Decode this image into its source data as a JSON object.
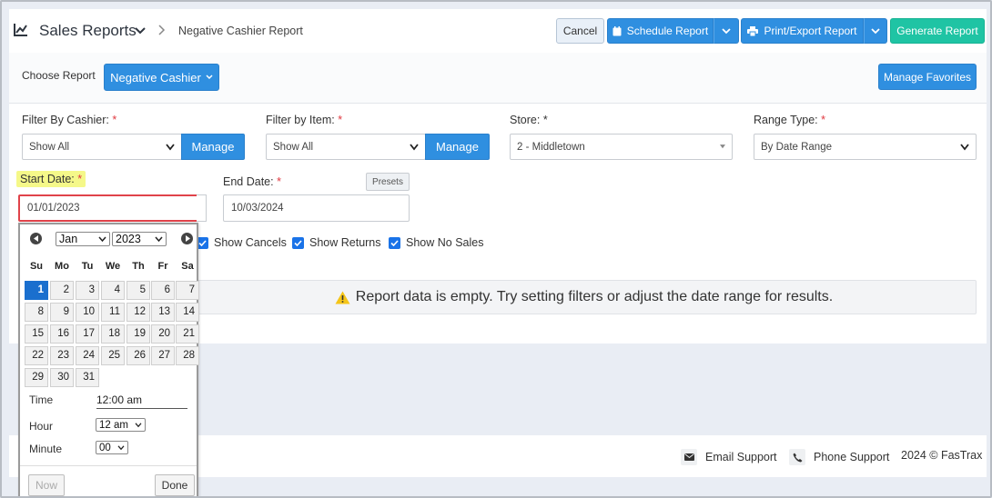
{
  "header": {
    "app_title": "Sales Reports",
    "breadcrumb": "Negative Cashier Report",
    "buttons": {
      "cancel": "Cancel",
      "schedule": "Schedule Report",
      "print_export": "Print/Export Report",
      "generate": "Generate Report"
    }
  },
  "choose_report": {
    "label": "Choose Report",
    "selected": "Negative Cashier",
    "manage_favorites": "Manage Favorites"
  },
  "filters": {
    "cashier": {
      "label": "Filter By Cashier:",
      "required": "*",
      "value": "Show All",
      "manage": "Manage"
    },
    "item": {
      "label": "Filter by Item:",
      "required": "*",
      "value": "Show All",
      "manage": "Manage"
    },
    "store": {
      "label": "Store: *",
      "value": "2 - Middletown"
    },
    "range_type": {
      "label": "Range Type:",
      "required": "*",
      "value": "By Date Range"
    },
    "start_date": {
      "label": "Start Date:",
      "required": "*",
      "value": "01/01/2023"
    },
    "end_date": {
      "label": "End Date:",
      "required": "*",
      "value": "10/03/2024"
    },
    "presets": "Presets"
  },
  "options": {
    "show_cancels": "Show Cancels",
    "show_returns": "Show Returns",
    "show_no_sales": "Show No Sales"
  },
  "empty_message": "Report data is empty. Try setting filters or adjust the date range for results.",
  "footer": {
    "email_support": "Email Support",
    "phone_support": "Phone Support",
    "copyright": "2024 © FasTrax"
  },
  "datepicker": {
    "month": "Jan",
    "year": "2023",
    "weekdays": [
      "Su",
      "Mo",
      "Tu",
      "We",
      "Th",
      "Fr",
      "Sa"
    ],
    "selected_day": "1",
    "days": [
      "1",
      "2",
      "3",
      "4",
      "5",
      "6",
      "7",
      "8",
      "9",
      "10",
      "11",
      "12",
      "13",
      "14",
      "15",
      "16",
      "17",
      "18",
      "19",
      "20",
      "21",
      "22",
      "23",
      "24",
      "25",
      "26",
      "27",
      "28",
      "29",
      "30",
      "31"
    ],
    "time_label": "Time",
    "time_value": "12:00 am",
    "hour_label": "Hour",
    "hour_value": "12 am",
    "minute_label": "Minute",
    "minute_value": "00",
    "now": "Now",
    "done": "Done"
  },
  "colors": {
    "primary_blue": "#2f8fe0",
    "generate_green": "#1fc4a4",
    "required_red": "#e0383f",
    "highlight_yellow": "#f5f889",
    "selected_day": "#1a6fce"
  }
}
